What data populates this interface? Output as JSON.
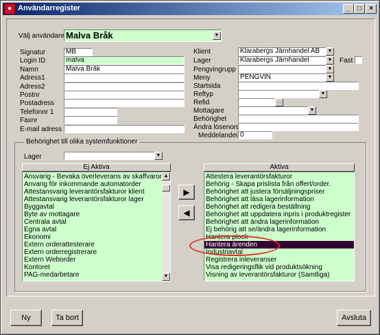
{
  "window": {
    "title": "Användarregister",
    "icon": "app-logo-icon",
    "controls": {
      "minimize": "_",
      "maximize": "□",
      "close": "×"
    }
  },
  "user_select": {
    "label": "Välj användare",
    "value": "Malva Bråk"
  },
  "left_fields": [
    {
      "label": "Signatur",
      "value": "MB"
    },
    {
      "label": "Login ID",
      "value": "malva"
    },
    {
      "label": "Namn",
      "value": "Malva Bråk"
    },
    {
      "label": "Adress1",
      "value": ""
    },
    {
      "label": "Adress2",
      "value": ""
    },
    {
      "label": "Postnr",
      "value": ""
    },
    {
      "label": "Postadress",
      "value": ""
    },
    {
      "label": "Telefonnr 1",
      "value": ""
    },
    {
      "label": "Faxnr",
      "value": ""
    },
    {
      "label": "E-mail adress",
      "value": ""
    }
  ],
  "right_fields": {
    "klient": {
      "label": "Klient",
      "value": "Klarabergs Järnhandel AB"
    },
    "lager": {
      "label": "Lager",
      "value": "Klarabergs Järnhandel"
    },
    "fast": {
      "label": "Fast"
    },
    "pengvinrupp": {
      "label": "Pengvingrupp",
      "value": ""
    },
    "meny": {
      "label": "Meny",
      "value": "PENGVIN"
    },
    "startsida": {
      "label": "Startsida",
      "value": ""
    },
    "reftyp": {
      "label": "Reftyp",
      "value": ""
    },
    "refid": {
      "label": "Refid",
      "value": "",
      "button": "..."
    },
    "mottagare": {
      "label": "Mottagare",
      "value": ""
    },
    "behorighet": {
      "label": "Behörighet",
      "value": ""
    },
    "andra_losenord": {
      "label": "Ändra lösenord",
      "value": ""
    },
    "meddelandeint": {
      "label": "Meddelandeint",
      "value": "0"
    }
  },
  "permissions": {
    "group_title": "Behörighet till olika systemfunktioner",
    "lager_label": "Lager",
    "lager_value": "",
    "inactive_header": "Ej Aktiva",
    "active_header": "Aktiva",
    "inactive_items": [
      "Ansvarig - Bevaka överleverans av skaffvaror.",
      "Anvarig för inkommande automatorder",
      "Attestansvarig leverantörsfakturor klient",
      "Attestansvarig leverantörsfakturor lager",
      "Byggavtal",
      "Byte av mottagare",
      "Centrala avtal",
      "Egna avtal",
      "Ekonomi",
      "Extern orderattesterare",
      "Extern orderregistrerare",
      "Extern Weborder",
      "Kontoret",
      "PAG-medarbetare"
    ],
    "active_items": [
      "Attestera leverantörsfakturor",
      "Behörig - Skapa prislista från offert/order.",
      "Behörighet att justera försäljningspriser",
      "Behörighet att läsa lagerinformation",
      "Behörighet att redigera beställning",
      "Behörighet att uppdatera inpris i produktregister",
      "Behörighet att ändra lagerinformation",
      "Ej behörig att se/ändra lagerinformation",
      "Hantera plock",
      "Hantera ärenden",
      "Industriavtal",
      "Registrera inleveranser",
      "Visa redigeringsflik vid produktsökning",
      "Visning av leverantörsfakturor (Samtliga)"
    ],
    "selected_active_index": 9,
    "move_right": "▶",
    "move_left": "◀"
  },
  "footer": {
    "new": "Ny",
    "delete": "Ta bort",
    "close": "Avsluta"
  },
  "colors": {
    "accent_green": "#ccffcc",
    "selection": "#330033",
    "annotation_ring": "#e0302a"
  }
}
